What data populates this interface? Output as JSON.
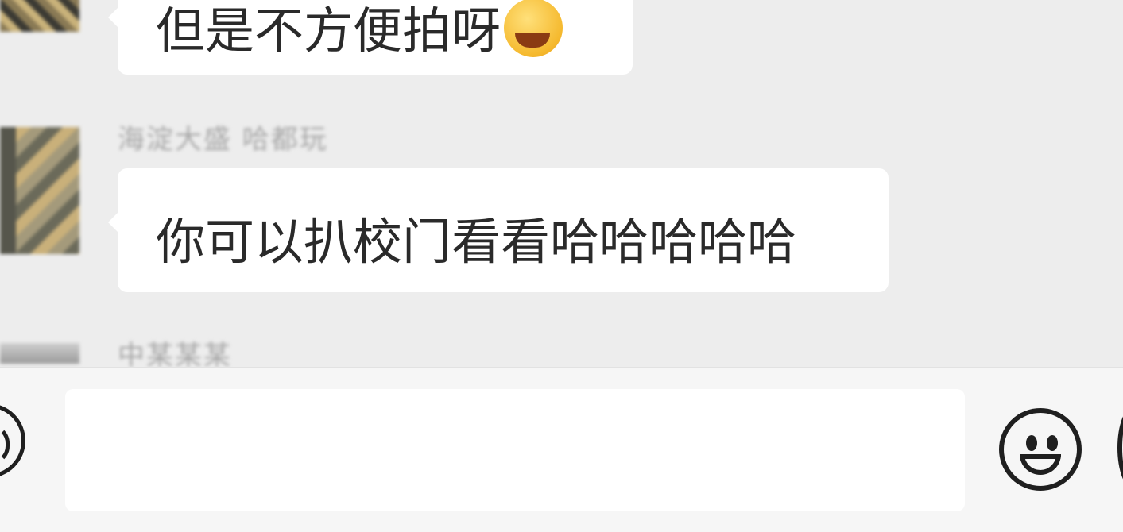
{
  "messages": [
    {
      "text": "但是不方便拍呀",
      "emoji": "rolling-on-floor-laughing-icon"
    },
    {
      "sender": "海淀大盛 哈都玩",
      "text": "你可以扒校门看看哈哈哈哈哈"
    }
  ],
  "next_sender": "中某某某",
  "input": {
    "value": "",
    "placeholder": ""
  },
  "icons": {
    "voice": "voice-icon",
    "emoji": "smiley-icon",
    "more": "plus-icon"
  },
  "colors": {
    "background": "#ededed",
    "bubble": "#ffffff",
    "input_bar": "#f6f6f6"
  }
}
